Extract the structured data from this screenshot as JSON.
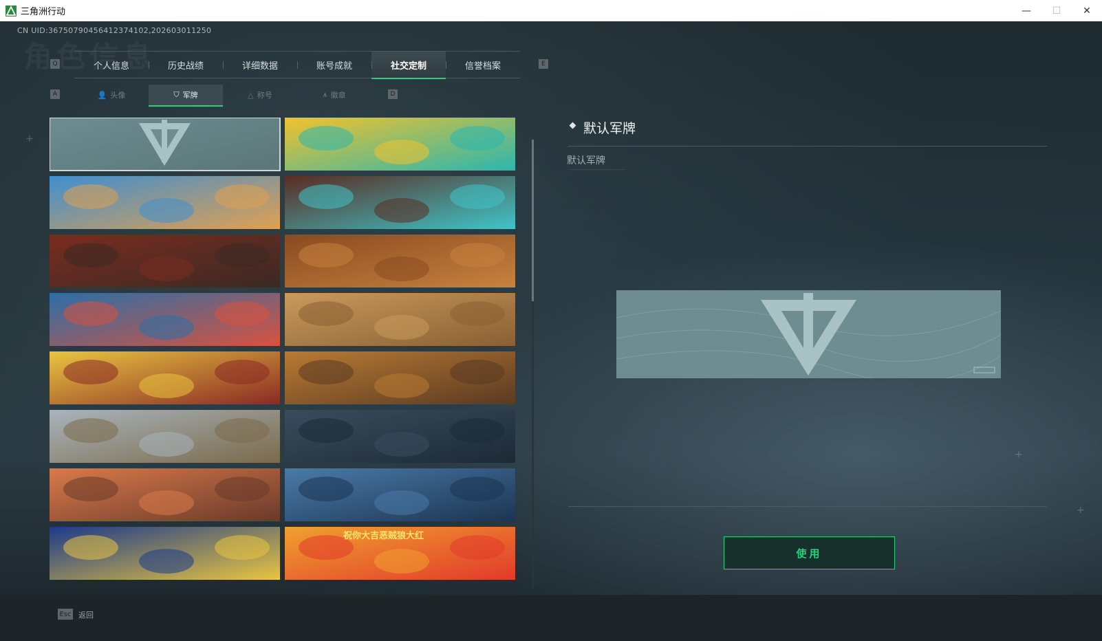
{
  "window": {
    "title": "三角洲行动",
    "controls": {
      "minimize": "—",
      "maximize": "☐",
      "close": "✕"
    }
  },
  "header": {
    "uid": "CN UID:3675079045641237410​2,202603011250",
    "bg_title": "角色信息"
  },
  "keys": {
    "prev_tab": "Q",
    "next_tab": "E",
    "prev_sub": "A",
    "next_sub": "D"
  },
  "tabs": [
    {
      "label": "个人信息",
      "active": false
    },
    {
      "label": "历史战绩",
      "active": false
    },
    {
      "label": "详细数据",
      "active": false
    },
    {
      "label": "账号成就",
      "active": false
    },
    {
      "label": "社交定制",
      "active": true
    },
    {
      "label": "信誉档案",
      "active": false
    }
  ],
  "subtabs": [
    {
      "label": "头像",
      "icon": "person-icon",
      "glyph": "👤",
      "active": false
    },
    {
      "label": "军牌",
      "icon": "badge-icon",
      "glyph": "⛉",
      "active": true
    },
    {
      "label": "称号",
      "icon": "triangle-icon",
      "glyph": "△",
      "active": false
    },
    {
      "label": "徽章",
      "icon": "wings-icon",
      "glyph": "⩚",
      "active": false
    }
  ],
  "cards": [
    {
      "name": "default",
      "selected": true,
      "colors": [
        "#6e8d90",
        "#5a7679"
      ]
    },
    {
      "name": "music",
      "selected": false,
      "colors": [
        "#f2c22b",
        "#2ab7b0"
      ]
    },
    {
      "name": "market",
      "selected": false,
      "colors": [
        "#3f8fd0",
        "#e0a050"
      ]
    },
    {
      "name": "tribal",
      "selected": false,
      "colors": [
        "#5a2c22",
        "#3fc5c9"
      ]
    },
    {
      "name": "soldiers",
      "selected": false,
      "colors": [
        "#7a2c1f",
        "#3a2a24"
      ]
    },
    {
      "name": "autumn",
      "selected": false,
      "colors": [
        "#8a4a20",
        "#c7823e"
      ]
    },
    {
      "name": "octopus",
      "selected": false,
      "colors": [
        "#2a6fa8",
        "#d8523e"
      ]
    },
    {
      "name": "blueprint",
      "selected": false,
      "colors": [
        "#c99a5c",
        "#8a6033"
      ]
    },
    {
      "name": "gold-dragon",
      "selected": false,
      "colors": [
        "#e9c540",
        "#8a2a24"
      ]
    },
    {
      "name": "feast",
      "selected": false,
      "colors": [
        "#b97a33",
        "#5a3a22"
      ]
    },
    {
      "name": "sniper",
      "selected": false,
      "colors": [
        "#a8b4bc",
        "#7b6a4a"
      ]
    },
    {
      "name": "squad",
      "selected": false,
      "colors": [
        "#3a4c5c",
        "#1c2a36"
      ]
    },
    {
      "name": "party",
      "selected": false,
      "colors": [
        "#d87a4a",
        "#6a3a2a"
      ]
    },
    {
      "name": "carrier",
      "selected": false,
      "colors": [
        "#4a7aa8",
        "#1c3552"
      ]
    },
    {
      "name": "golden-mask",
      "selected": false,
      "colors": [
        "#1c3a8a",
        "#e9c540"
      ]
    },
    {
      "name": "chibi",
      "selected": false,
      "colors": [
        "#f0a030",
        "#e23a2a"
      ]
    }
  ],
  "card_texts": {
    "chibi_banner": "祝你大吉恶贼狼大红"
  },
  "detail": {
    "title": "默认军牌",
    "subtitle": "默认军牌",
    "use_button": "使用"
  },
  "footer": {
    "esc_key": "Esc",
    "back_label": "返回"
  },
  "colors": {
    "accent": "#27d07a",
    "bg": "#1d2a30"
  }
}
